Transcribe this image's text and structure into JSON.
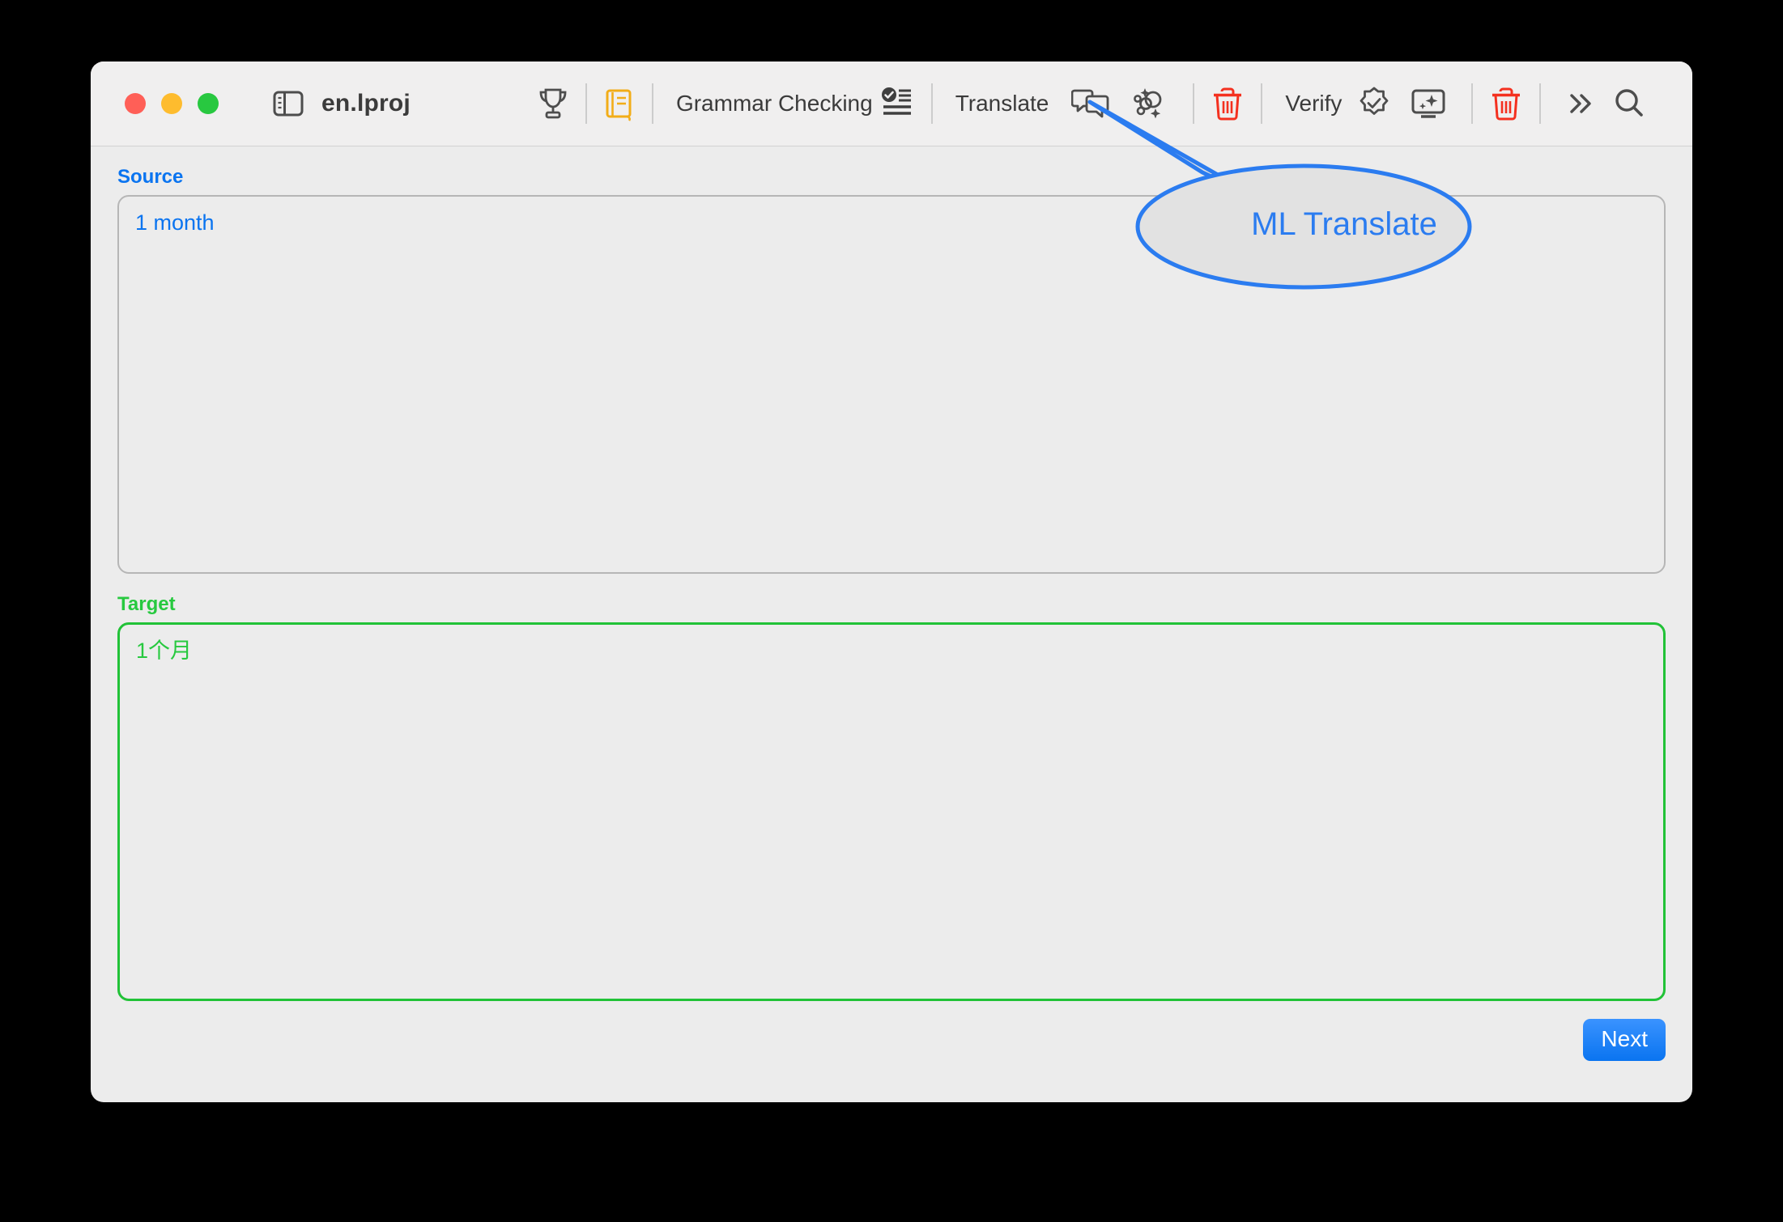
{
  "window": {
    "title": "en.lproj",
    "traffic_lights": [
      "close-button",
      "minimize-button",
      "zoom-button"
    ]
  },
  "toolbar": {
    "sidebar_toggle_icon": "sidebar-toggle-icon",
    "items": [
      {
        "icon": "trophy-icon",
        "label": ""
      },
      {
        "icon": "dictionary-book-icon",
        "label": ""
      },
      {
        "icon": "grammar-checklist-icon",
        "label": "Grammar Checking"
      },
      {
        "icon": "speech-bubble-icon",
        "label": "Translate"
      },
      {
        "icon": "sparkles-icon",
        "label": ""
      },
      {
        "icon": "trash-icon",
        "label": ""
      },
      {
        "icon": "verify-seal-icon",
        "label": "Verify"
      },
      {
        "icon": "display-sparkle-icon",
        "label": ""
      },
      {
        "icon": "trash-icon",
        "label": ""
      },
      {
        "icon": "chevron-double-right-icon",
        "label": ""
      },
      {
        "icon": "search-icon",
        "label": ""
      }
    ],
    "grammar_label": "Grammar Checking",
    "translate_label": "Translate",
    "verify_label": "Verify"
  },
  "main": {
    "source": {
      "label": "Source",
      "value": "1 month",
      "placeholder": ""
    },
    "target": {
      "label": "Target",
      "value": "1个月",
      "placeholder": ""
    },
    "next_label": "Next"
  },
  "annotation": {
    "callout_text": "ML Translate"
  },
  "colors": {
    "accent_blue": "#0a74f0",
    "target_green": "#27c93f",
    "callout_blue": "#2b7cf0",
    "trash_red": "#f4301f",
    "book_yellow": "#f2ad18",
    "toolbar_gray": "#4d4d4d"
  }
}
